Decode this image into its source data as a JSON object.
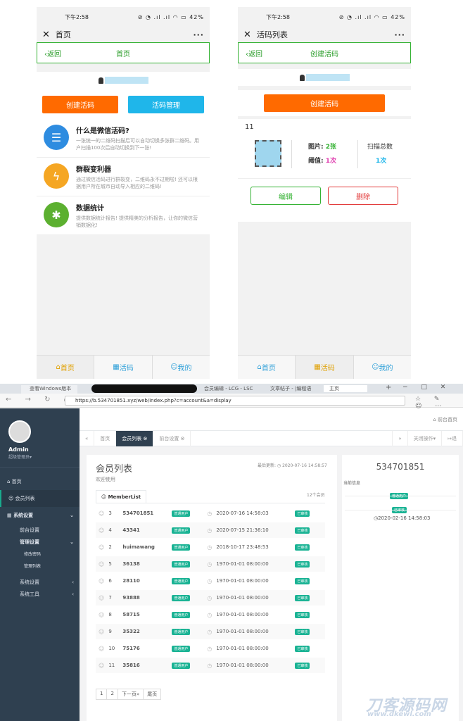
{
  "phone1": {
    "status_time": "下午2:58",
    "status_icons": "⊘ ◔ .ıl .ıl ◠ ▭ 42%",
    "title": "首页",
    "nav_back": "返回",
    "nav_title": "首页",
    "btn_create": "创建活码",
    "btn_manage": "活码管理",
    "features": [
      {
        "icon": "clipboard-icon",
        "title": "什么是微信活码?",
        "desc": "一张统一的二维码扫描后可以自动切换多张群二维码。用户扫描100次后自动切换到下一张!"
      },
      {
        "icon": "lightning-icon",
        "title": "群裂变利器",
        "desc": "通过微信活码进行群裂变，二维码永不过期啦! 还可以根据用户所在城市自动导入相应的二维码!"
      },
      {
        "icon": "gear-icon",
        "title": "数据统计",
        "desc": "提供数据统计报告! 提供精美的分析报告，让你的微信营销数据化!"
      }
    ],
    "tabbar": [
      {
        "label": "首页"
      },
      {
        "label": "活码"
      },
      {
        "label": "我的"
      }
    ]
  },
  "phone2": {
    "status_time": "下午2:58",
    "status_icons": "⊘ ◔ .ıl .ıl ◠ ▭ 42%",
    "title": "活码列表",
    "nav_back": "返回",
    "nav_title": "创建活码",
    "btn_create": "创建活码",
    "code_name": "11",
    "pic_label": "图片:",
    "pic_value": "2张",
    "threshold_label": "阈值:",
    "threshold_value": "1次",
    "scan_label": "扫描总数",
    "scan_value": "1次",
    "edit": "编辑",
    "delete": "删除",
    "tabbar": [
      {
        "label": "首页"
      },
      {
        "label": "活码"
      },
      {
        "label": "我的"
      }
    ]
  },
  "browser": {
    "tab1": "查看Windows版本",
    "tab3": "会员编辑 - LCG - LSC",
    "tab4": "文章帖子 - |编程语",
    "tab5": "主页",
    "url": "https://b.534701851.xyz/web/index.php?c=account&a=display"
  },
  "admin": {
    "user_name": "Admin",
    "user_role": "超级管理员",
    "menu": {
      "home": "首页",
      "members": "会员列表",
      "system": "系统设置",
      "frontend": "前台设置",
      "manage": "管理设置",
      "change_pwd": "修改密码",
      "admin_list": "管理列表",
      "sys_settings": "系统设置",
      "sys_tools": "系统工具"
    },
    "top_link": "前台首页",
    "tabs": {
      "home": "首页",
      "members": "会员列表",
      "front": "前台设置",
      "close_ops": "关闭操作",
      "back": "退"
    },
    "panel_title": "会员列表",
    "panel_sub": "欢迎使用",
    "last_update": "最后更新: ◷ 2020-07-16 14:58:57",
    "list_tab": "MemberList",
    "count": "12个会员",
    "members": [
      {
        "id": "3",
        "name": "534701851",
        "type": "普通用户",
        "time": "2020-07-16 14:58:03",
        "status": "已审核"
      },
      {
        "id": "4",
        "name": "43341",
        "type": "普通用户",
        "time": "2020-07-15 21:36:10",
        "status": "已审核"
      },
      {
        "id": "2",
        "name": "huimawang",
        "type": "普通用户",
        "time": "2018-10-17 23:48:53",
        "status": "已审核"
      },
      {
        "id": "5",
        "name": "36138",
        "type": "普通用户",
        "time": "1970-01-01 08:00:00",
        "status": "已审核"
      },
      {
        "id": "6",
        "name": "28110",
        "type": "普通用户",
        "time": "1970-01-01 08:00:00",
        "status": "已审核"
      },
      {
        "id": "7",
        "name": "93888",
        "type": "普通用户",
        "time": "1970-01-01 08:00:00",
        "status": "已审核"
      },
      {
        "id": "8",
        "name": "58715",
        "type": "普通用户",
        "time": "1970-01-01 08:00:00",
        "status": "已审核"
      },
      {
        "id": "9",
        "name": "35322",
        "type": "普通用户",
        "time": "1970-01-01 08:00:00",
        "status": "已审核"
      },
      {
        "id": "10",
        "name": "75176",
        "type": "普通用户",
        "time": "1970-01-01 08:00:00",
        "status": "已审核"
      },
      {
        "id": "11",
        "name": "35816",
        "type": "普通用户",
        "time": "1970-01-01 08:00:00",
        "status": "已审核"
      }
    ],
    "pager": {
      "p1": "1",
      "p2": "2",
      "next": "下一页»",
      "last": "尾页"
    },
    "detail": {
      "name": "534701851",
      "info_label": "当前信息",
      "type": "普通用户",
      "status": "已审核",
      "time": "◷2020-02-16 14:58:03"
    }
  },
  "watermark": {
    "main": "刀客源码网",
    "url": "www.dkewl.com"
  },
  "colors": {
    "orange": "#ff6a00",
    "blue": "#1fb6ea",
    "green": "#34b233",
    "red": "#e23b3b",
    "sidebar": "#2f4050",
    "badge": "#1ab394"
  }
}
